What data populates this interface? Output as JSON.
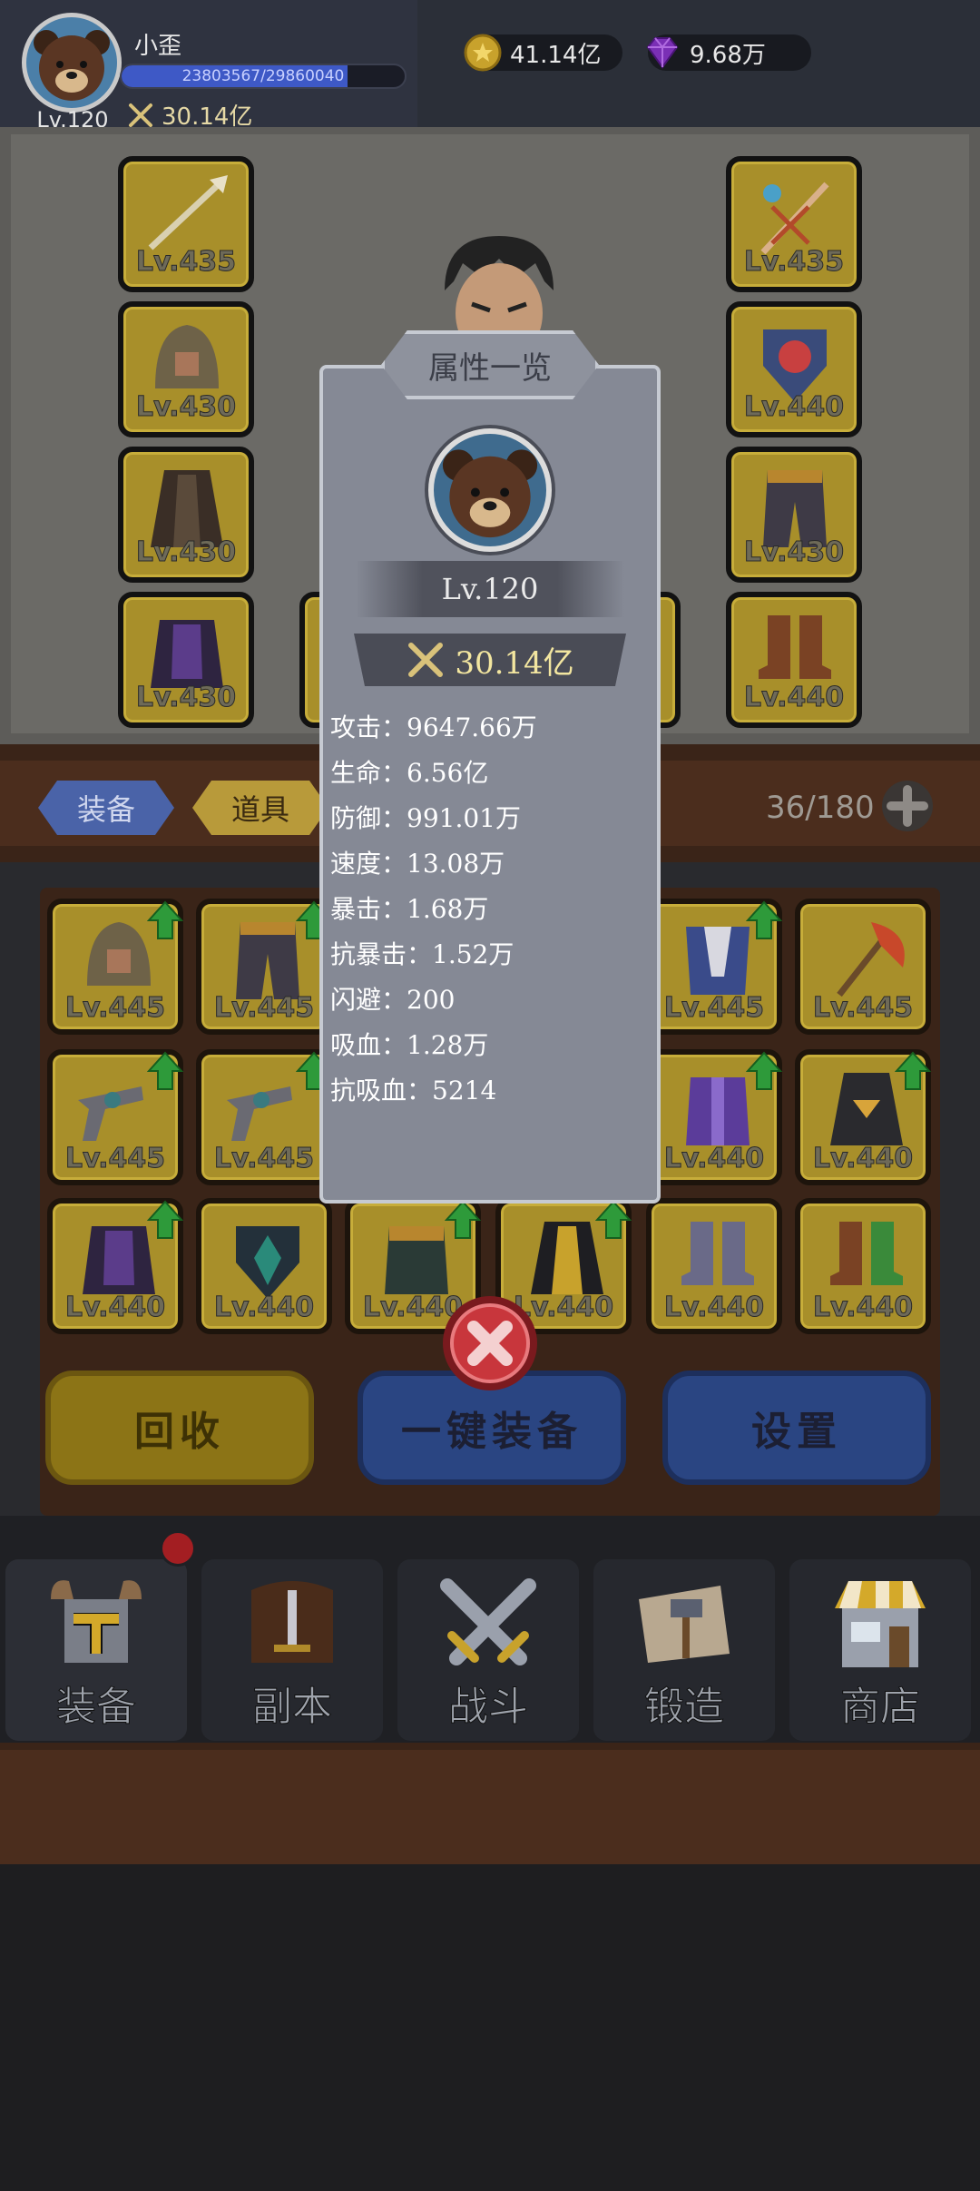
{
  "player": {
    "name": "小歪",
    "level": "Lv.120",
    "exp_text": "23803567/29860040",
    "exp_fraction": 0.797,
    "power": "30.14亿"
  },
  "currency": {
    "gold": "41.14亿",
    "gems": "9.68万"
  },
  "equipped": {
    "left": [
      "Lv.435",
      "Lv.430",
      "Lv.430",
      "Lv.430"
    ],
    "right": [
      "Lv.435",
      "Lv.440",
      "Lv.430",
      "Lv.440"
    ]
  },
  "tabs": {
    "equip": "装备",
    "items": "道具"
  },
  "bag_count": "36/180",
  "inventory": {
    "row1": [
      "Lv.445",
      "Lv.445",
      "Lv.445",
      "Lv.445"
    ],
    "row2": [
      "Lv.445",
      "Lv.445",
      "Lv.440",
      "Lv.440"
    ],
    "row3": [
      "Lv.440",
      "Lv.440",
      "Lv.440",
      "Lv.440",
      "Lv.440",
      "Lv.440"
    ]
  },
  "buttons": {
    "recycle": "回收",
    "equip_all": "一键装备",
    "settings": "设置"
  },
  "nav": {
    "equipment": "装备",
    "dungeon": "副本",
    "battle": "战斗",
    "forge": "锻造",
    "shop": "商店"
  },
  "modal": {
    "title": "属性一览",
    "level": "Lv.120",
    "power": "30.14亿",
    "stats": [
      "攻击：9647.66万",
      "生命：6.56亿",
      "防御：991.01万",
      "速度：13.08万",
      "暴击：1.68万",
      "抗暴击：1.52万",
      "闪避：200",
      "吸血：1.28万",
      "抗吸血：5214"
    ]
  },
  "colors": {
    "gear_slot": "#a88f2a",
    "upgrade_arrow": "#2e9a3a",
    "modal_bg": "#858995",
    "power_text": "#f3e6a0"
  }
}
